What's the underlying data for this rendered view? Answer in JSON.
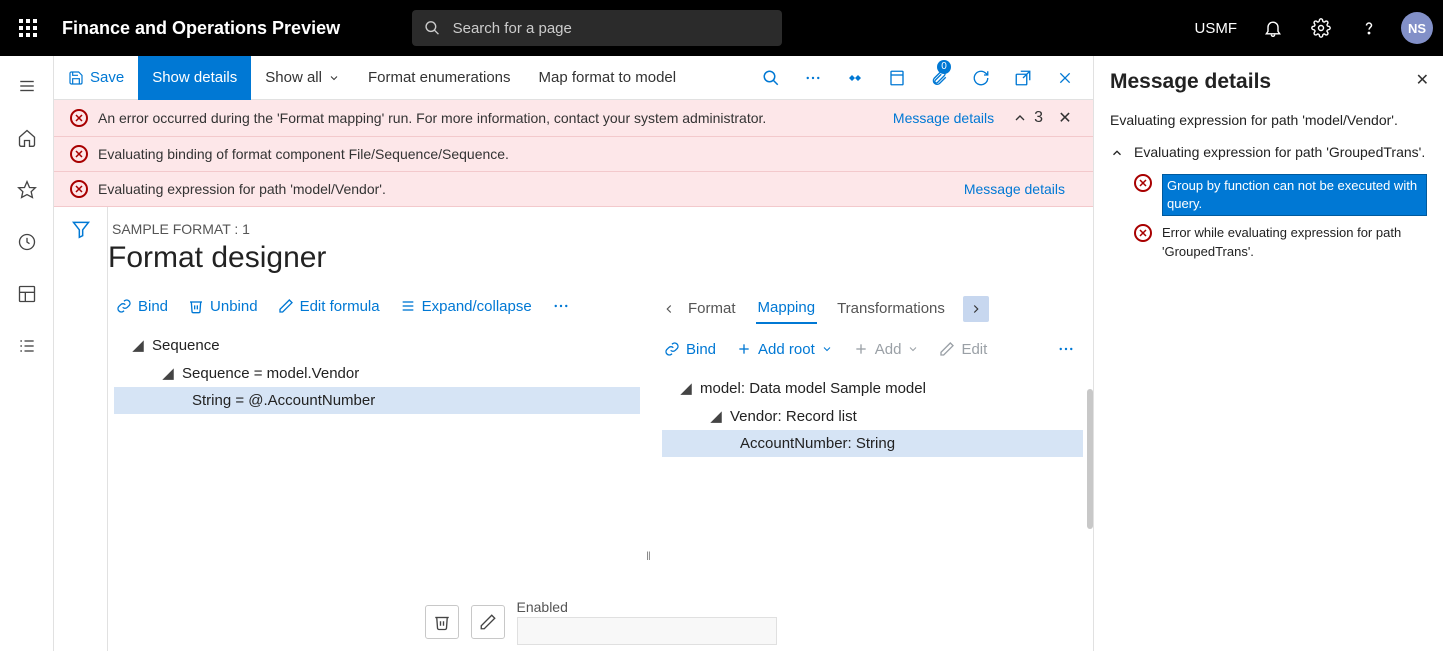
{
  "header": {
    "app_title": "Finance and Operations Preview",
    "search_placeholder": "Search for a page",
    "legal_entity": "USMF",
    "avatar_initials": "NS"
  },
  "actionbar": {
    "save": "Save",
    "show_details": "Show details",
    "show_all": "Show all",
    "format_enum": "Format enumerations",
    "map_format": "Map format to model",
    "attachments_badge": "0"
  },
  "errors": {
    "row1": "An error occurred during the 'Format mapping' run. For more information, contact your system administrator.",
    "row2": "Evaluating binding of format component File/Sequence/Sequence.",
    "row3": "Evaluating expression for path 'model/Vendor'.",
    "details_link": "Message details",
    "count": "3"
  },
  "designer": {
    "breadcrumb": "SAMPLE FORMAT : 1",
    "title": "Format designer",
    "left_toolbar": {
      "bind": "Bind",
      "unbind": "Unbind",
      "edit_formula": "Edit formula",
      "expand": "Expand/collapse"
    },
    "left_tree": {
      "n1": "Sequence",
      "n2": "Sequence = model.Vendor",
      "n3": "String = @.AccountNumber"
    },
    "tabs": {
      "format": "Format",
      "mapping": "Mapping",
      "transformations": "Transformations"
    },
    "right_toolbar": {
      "bind": "Bind",
      "add_root": "Add root",
      "add": "Add",
      "edit": "Edit"
    },
    "right_tree": {
      "n1": "model: Data model Sample model",
      "n2": "Vendor: Record list",
      "n3": "AccountNumber: String"
    },
    "bottom": {
      "enabled": "Enabled"
    }
  },
  "sidepanel": {
    "title": "Message details",
    "subtitle": "Evaluating expression for path 'model/Vendor'.",
    "group_label": "Evaluating expression for path 'GroupedTrans'.",
    "item1": "Group by function can not be executed with query.",
    "item2": "Error while evaluating expression for path 'GroupedTrans'."
  }
}
